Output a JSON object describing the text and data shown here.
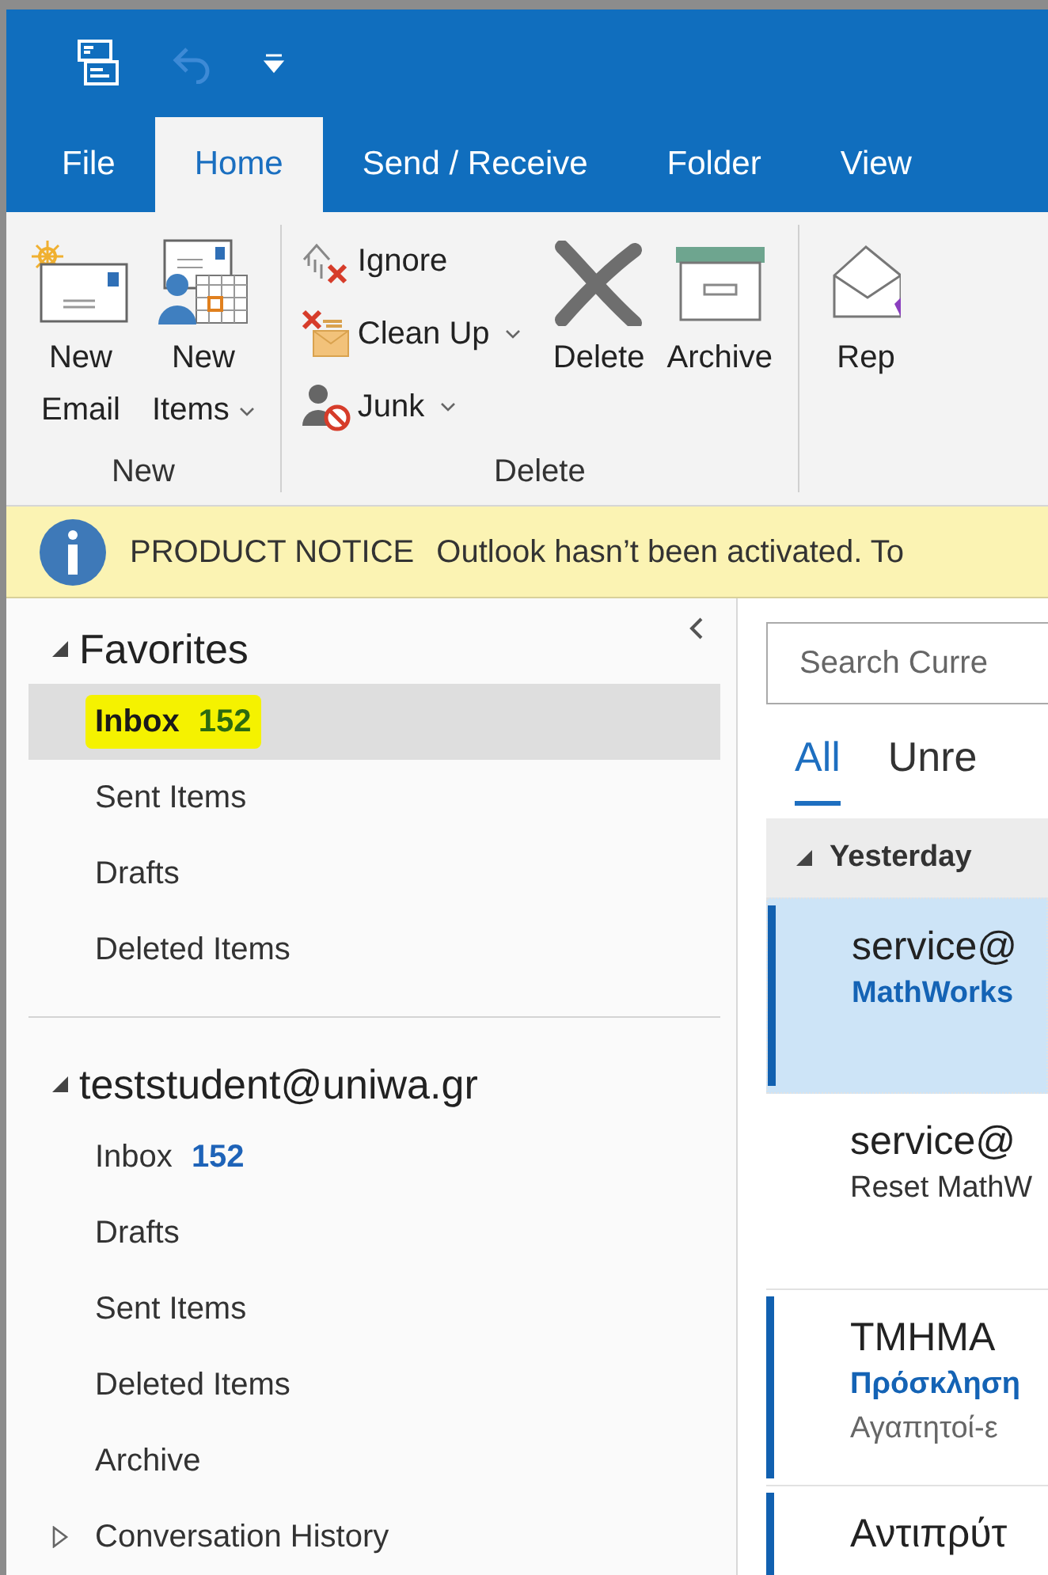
{
  "tabs": [
    {
      "label": "File",
      "selected": false
    },
    {
      "label": "Home",
      "selected": true
    },
    {
      "label": "Send / Receive",
      "selected": false
    },
    {
      "label": "Folder",
      "selected": false
    },
    {
      "label": "View",
      "selected": false
    }
  ],
  "ribbon": {
    "groups": [
      {
        "label": "New",
        "buttons": [
          {
            "kind": "large",
            "lines": [
              "New",
              "Email"
            ],
            "dropdown": false
          },
          {
            "kind": "large",
            "lines": [
              "New",
              "Items"
            ],
            "dropdown": true
          }
        ]
      },
      {
        "label": "Delete",
        "buttons": [
          {
            "kind": "small",
            "lines": [
              "Ignore"
            ],
            "dropdown": false
          },
          {
            "kind": "small",
            "lines": [
              "Clean Up"
            ],
            "dropdown": true
          },
          {
            "kind": "small",
            "lines": [
              "Junk"
            ],
            "dropdown": true
          },
          {
            "kind": "large",
            "lines": [
              "Delete"
            ],
            "dropdown": false
          },
          {
            "kind": "large",
            "lines": [
              "Archive"
            ],
            "dropdown": false
          }
        ]
      },
      {
        "buttons": [
          {
            "kind": "large",
            "lines": [
              "Rep"
            ],
            "dropdown": false
          }
        ]
      }
    ]
  },
  "notice": {
    "title": "PRODUCT NOTICE",
    "text": "Outlook hasn’t been activated. To"
  },
  "folder_pane": {
    "sections": [
      {
        "label": "Favorites",
        "expanded": true,
        "items": [
          {
            "kind": "folder",
            "label": "Inbox",
            "count": "152",
            "selected": true,
            "highlighted": true
          },
          {
            "kind": "folder",
            "label": "Sent Items",
            "selected": false,
            "highlighted": false
          },
          {
            "kind": "folder",
            "label": "Drafts",
            "selected": false,
            "highlighted": false
          },
          {
            "kind": "folder",
            "label": "Deleted Items",
            "selected": false,
            "highlighted": false
          }
        ]
      },
      {
        "label": "teststudent@uniwa.gr",
        "expanded": true,
        "items": [
          {
            "kind": "folder",
            "label": "Inbox",
            "count": "152",
            "selected": false,
            "highlighted": false
          },
          {
            "kind": "folder",
            "label": "Drafts",
            "selected": false,
            "highlighted": false
          },
          {
            "kind": "folder",
            "label": "Sent Items",
            "selected": false,
            "highlighted": false
          },
          {
            "kind": "folder",
            "label": "Deleted Items",
            "selected": false,
            "highlighted": false
          },
          {
            "kind": "folder",
            "label": "Archive",
            "selected": false,
            "highlighted": false
          },
          {
            "kind": "expandable",
            "label": "Conversation History",
            "expanded": false,
            "selected": false,
            "highlighted": false
          }
        ]
      }
    ]
  },
  "message_list": {
    "search": {
      "placeholder": "Search Curre"
    },
    "filters": [
      {
        "label": "All",
        "selected": true
      },
      {
        "label": "Unre",
        "selected": false
      }
    ],
    "date_header": {
      "label": "Yesterday",
      "expanded": true
    },
    "messages": [
      {
        "sender": "service@",
        "subject": "MathWorks",
        "unread": true,
        "selected": true
      },
      {
        "sender": "service@",
        "subject": "Reset MathW",
        "unread": false,
        "selected": false
      },
      {
        "sender": "TMHMA",
        "subject": "Πρόσκληση",
        "preview": "Αγαπητοί-ε",
        "unread": true,
        "selected": false
      },
      {
        "sender": "Αντιπρύτ",
        "unread": true,
        "selected": false
      }
    ]
  }
}
